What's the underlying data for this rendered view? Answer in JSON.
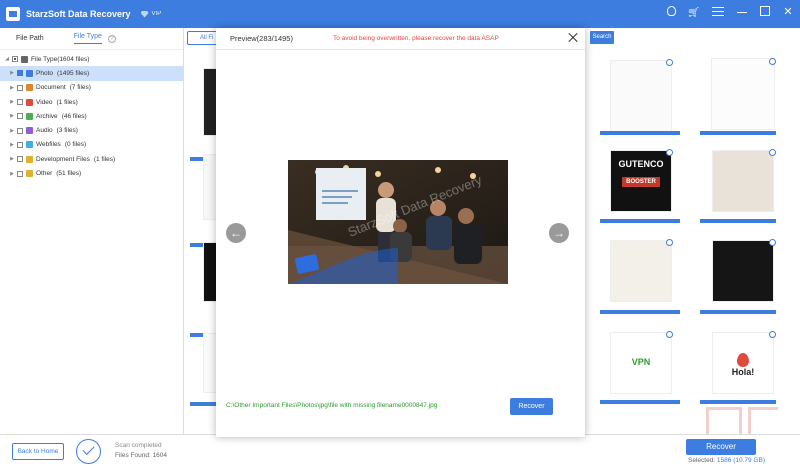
{
  "app": {
    "title": "StarzSoft Data Recovery",
    "vip": "VIP"
  },
  "sidebar": {
    "tabs": [
      "File Path",
      "File Type"
    ],
    "help": "?",
    "tree": [
      {
        "label": "File Type(1604 files)",
        "level": 0,
        "state": "part",
        "icon": "drive-icon",
        "color": "#666666"
      },
      {
        "label": "Photo",
        "count": "(1495 files)",
        "level": 1,
        "state": "checked",
        "selected": true,
        "icon": "photo-icon",
        "color": "#3d7de0"
      },
      {
        "label": "Document",
        "count": "(7 files)",
        "level": 1,
        "state": "none",
        "icon": "document-icon",
        "color": "#e0862e"
      },
      {
        "label": "Video",
        "count": "(1 files)",
        "level": 1,
        "state": "none",
        "icon": "video-icon",
        "color": "#e04a3d"
      },
      {
        "label": "Archive",
        "count": "(46 files)",
        "level": 1,
        "state": "none",
        "icon": "archive-icon",
        "color": "#4caf50"
      },
      {
        "label": "Audio",
        "count": "(3 files)",
        "level": 1,
        "state": "none",
        "icon": "audio-icon",
        "color": "#8e5ed9"
      },
      {
        "label": "Webfiles",
        "count": "(0 files)",
        "level": 1,
        "state": "none",
        "icon": "webfiles-icon",
        "color": "#3db0e0"
      },
      {
        "label": "Development Files",
        "count": "(1 files)",
        "level": 1,
        "state": "none",
        "icon": "dev-files-icon",
        "color": "#e0b12e"
      },
      {
        "label": "Other",
        "count": "(51 files)",
        "level": 1,
        "state": "none",
        "icon": "other-icon",
        "color": "#e0b12e"
      }
    ]
  },
  "main": {
    "all_files_tab": "All Fi",
    "search_label": "Search"
  },
  "preview": {
    "title": "Preview(283/1495)",
    "warning": "To avoid being overwritten, please recover the data ASAP",
    "path": "C:\\Other Important Files\\Photos\\jpg\\file with missing filename0000847.jpg",
    "recover_label": "Recover",
    "prev": "←",
    "next": "→",
    "watermark": "StarzSoft Data Recovery"
  },
  "bottom": {
    "back_label": "Back to Home",
    "scan_status": "Scan completed",
    "files_found": "Files Found: 1604",
    "recover_label": "Recover",
    "selected_label": "Selected:",
    "selected_value": "1586 (10.79 GB)"
  },
  "thumbs": {
    "tile_gutenco_title": "GUTENCO",
    "tile_gutenco_sub": "BOOSTER",
    "tile_vpn": "VPN",
    "tile_hola": "Hola!"
  },
  "colors": {
    "accent": "#3d7de0",
    "warning": "#ee4444",
    "path": "#2e9a2e"
  }
}
